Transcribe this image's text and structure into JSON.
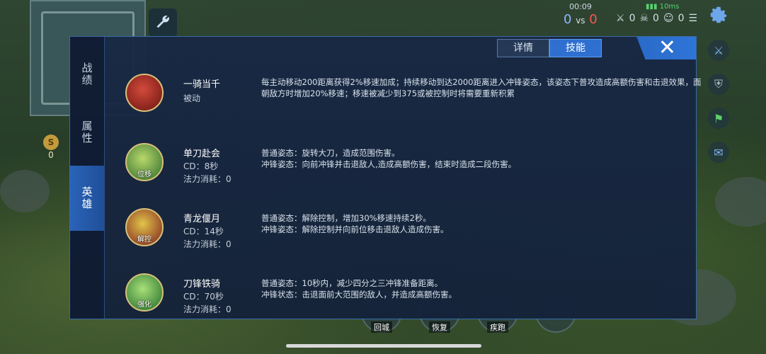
{
  "hud": {
    "time": "00:09",
    "score_blue": "0",
    "score_vs": "vs",
    "score_red": "0",
    "ping": "10ms",
    "kills": "0",
    "deaths": "0",
    "assists": "0",
    "gold": "0",
    "gold_icon_text": "S"
  },
  "panel": {
    "side_tabs": [
      "战绩",
      "属性",
      "英雄"
    ],
    "tabs": [
      "详情",
      "技能"
    ],
    "active_tab": "技能",
    "close_glyph": "✕"
  },
  "skills": [
    {
      "name": "一骑当千",
      "meta1": "被动",
      "meta2": "",
      "icon_label": "",
      "desc1": "每主动移动200距离获得2%移速加成；持续移动到达2000距离进入冲锋姿态，该姿态下普攻造成高额伤害和击退效果，面朝敌方时增加20%移速；移速被减少到375或被控制时将需要重新积累",
      "desc2": ""
    },
    {
      "name": "单刀赴会",
      "meta1": "CD：8秒",
      "meta2": "法力消耗：0",
      "icon_label": "位移",
      "desc1": "普通姿态：旋转大刀，造成范围伤害。",
      "desc2": "冲锋姿态：向前冲锋并击退敌人,造成高额伤害，结束时造成二段伤害。"
    },
    {
      "name": "青龙偃月",
      "meta1": "CD：14秒",
      "meta2": "法力消耗：0",
      "icon_label": "解控",
      "desc1": "普通姿态：解除控制，增加30%移速持续2秒。",
      "desc2": "冲锋姿态：解除控制并向前位移击退敌人造成伤害。"
    },
    {
      "name": "刀锋铁骑",
      "meta1": "CD：70秒",
      "meta2": "法力消耗：0",
      "icon_label": "强化",
      "desc1": "普通姿态：10秒内，减少四分之三冲锋准备距离。",
      "desc2": "冲锋状态：击退面前大范围的敌人，并造成高额伤害。"
    }
  ],
  "bottom_buttons": [
    "回城",
    "恢复",
    "疾跑"
  ],
  "colors": {
    "panel_bg": "#182844",
    "accent": "#2e6fd0",
    "score_blue": "#8fb6ff",
    "score_red": "#ff5555"
  }
}
